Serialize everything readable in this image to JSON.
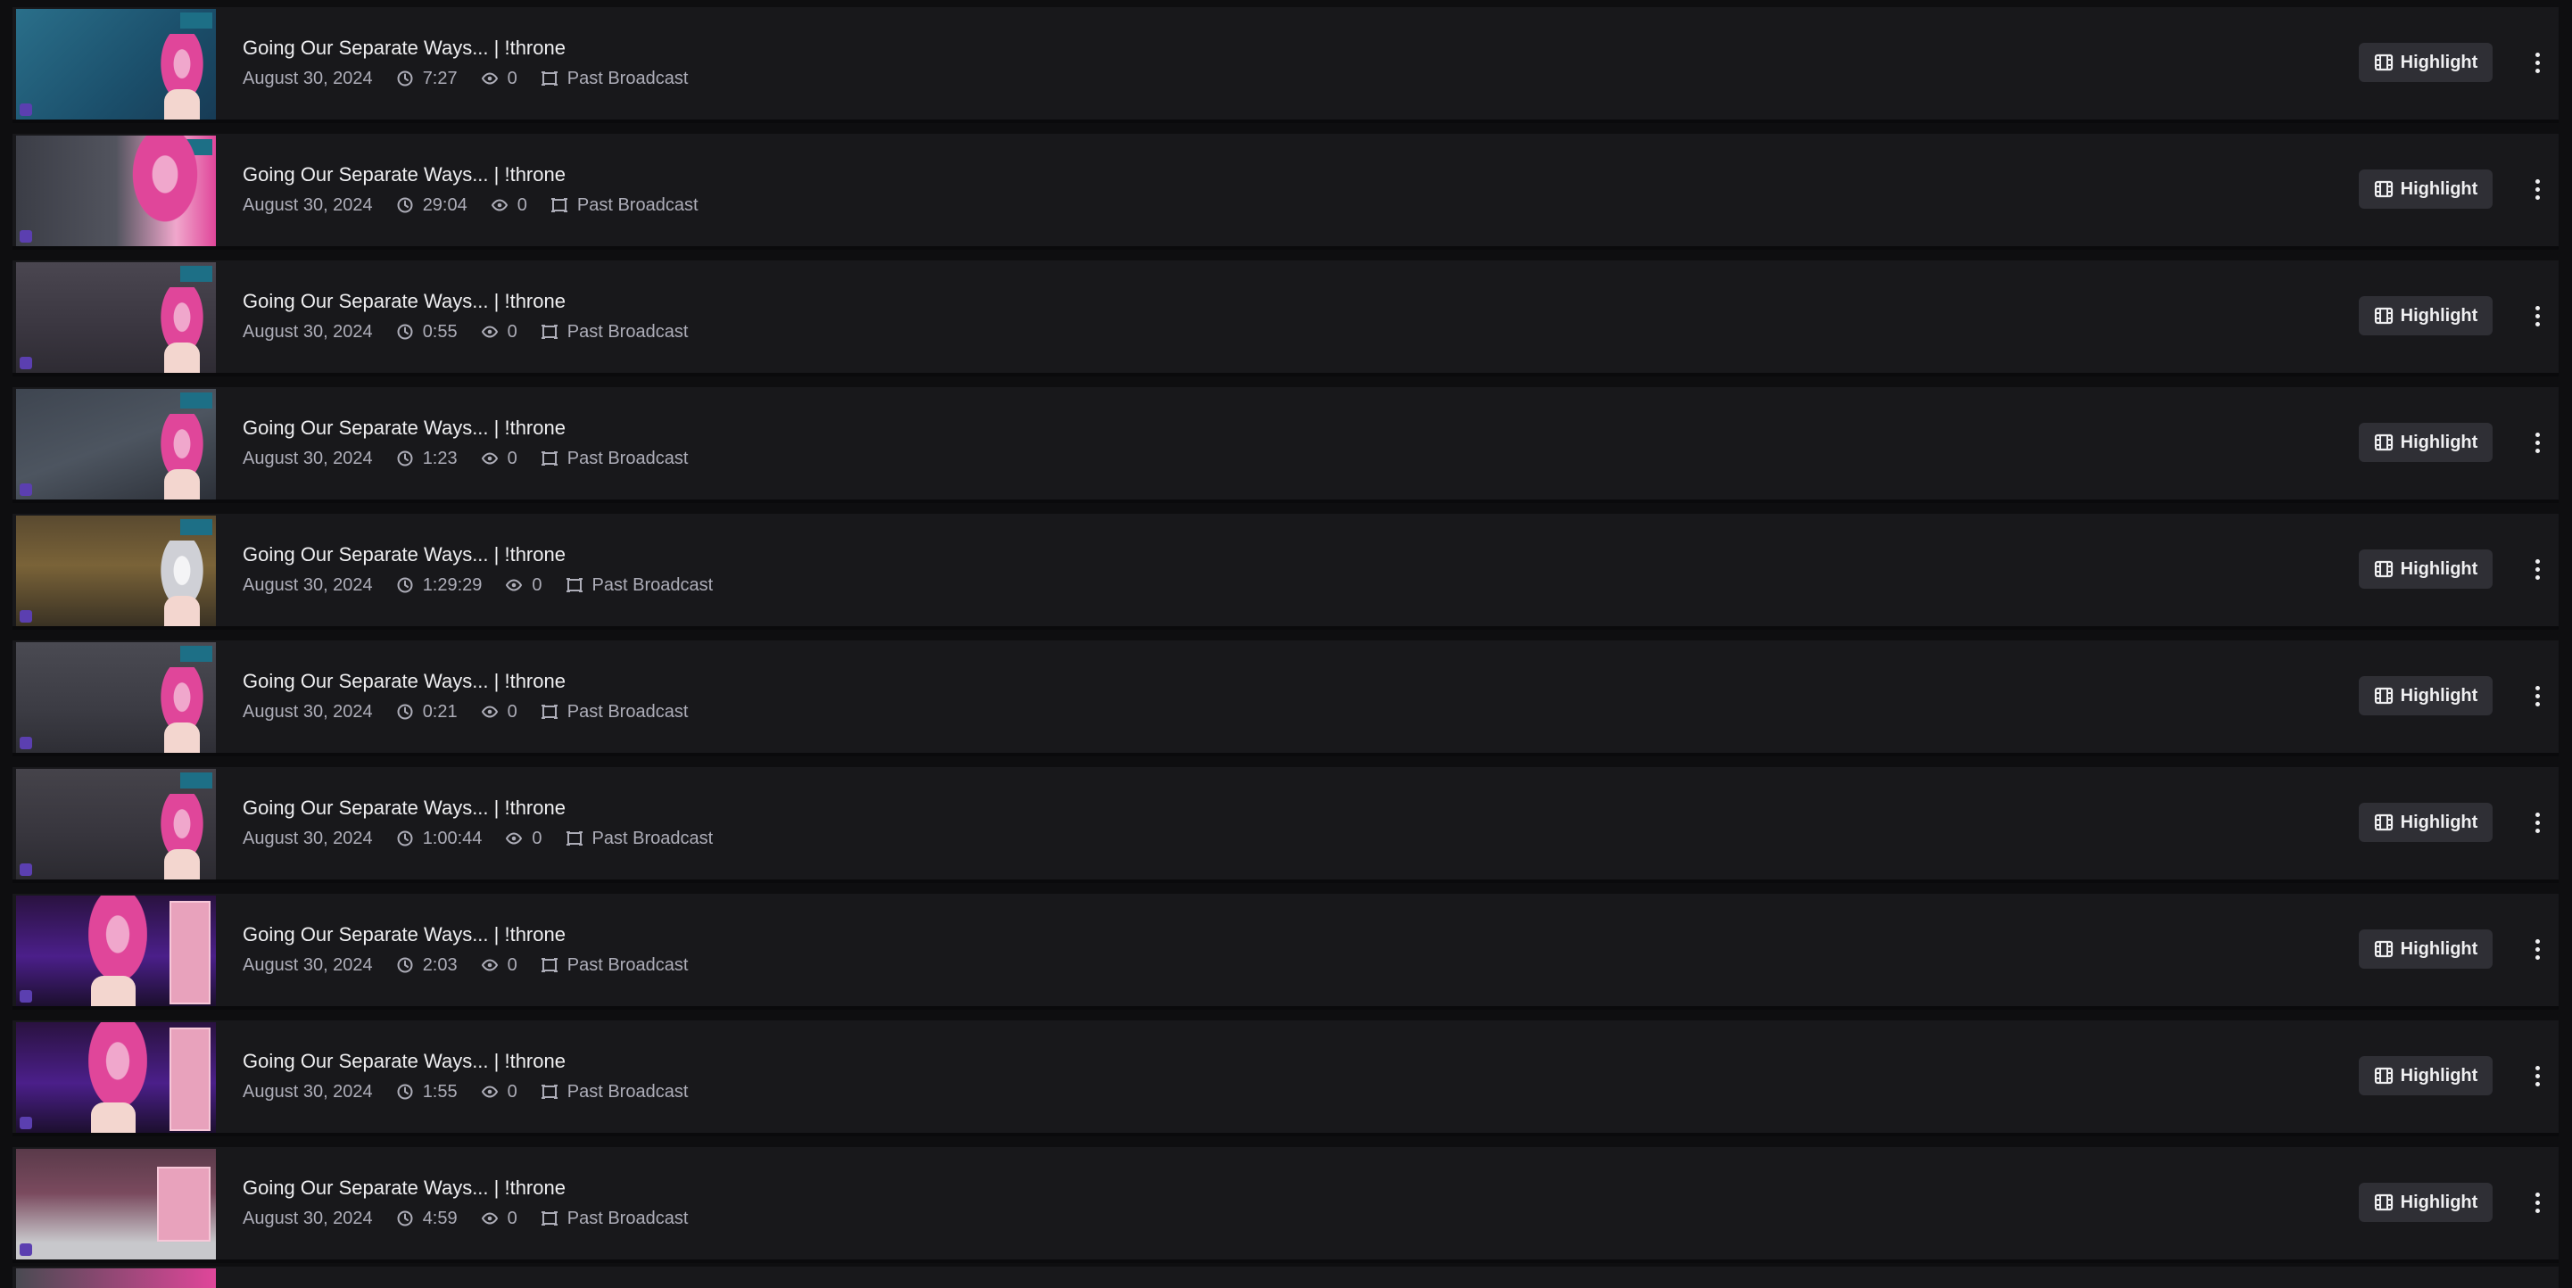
{
  "highlight_label": "Highlight",
  "icons": {
    "duration": "clock-icon",
    "views": "eye-icon",
    "type": "broadcast-icon",
    "highlight": "film-icon",
    "more": "kebab-icon"
  },
  "videos": [
    {
      "title": "Going Our Separate Ways... | !throne",
      "date": "August 30, 2024",
      "duration": "7:27",
      "views": "0",
      "type": "Past Broadcast"
    },
    {
      "title": "Going Our Separate Ways... | !throne",
      "date": "August 30, 2024",
      "duration": "29:04",
      "views": "0",
      "type": "Past Broadcast"
    },
    {
      "title": "Going Our Separate Ways... | !throne",
      "date": "August 30, 2024",
      "duration": "0:55",
      "views": "0",
      "type": "Past Broadcast"
    },
    {
      "title": "Going Our Separate Ways... | !throne",
      "date": "August 30, 2024",
      "duration": "1:23",
      "views": "0",
      "type": "Past Broadcast"
    },
    {
      "title": "Going Our Separate Ways... | !throne",
      "date": "August 30, 2024",
      "duration": "1:29:29",
      "views": "0",
      "type": "Past Broadcast"
    },
    {
      "title": "Going Our Separate Ways... | !throne",
      "date": "August 30, 2024",
      "duration": "0:21",
      "views": "0",
      "type": "Past Broadcast"
    },
    {
      "title": "Going Our Separate Ways... | !throne",
      "date": "August 30, 2024",
      "duration": "1:00:44",
      "views": "0",
      "type": "Past Broadcast"
    },
    {
      "title": "Going Our Separate Ways... | !throne",
      "date": "August 30, 2024",
      "duration": "2:03",
      "views": "0",
      "type": "Past Broadcast"
    },
    {
      "title": "Going Our Separate Ways... | !throne",
      "date": "August 30, 2024",
      "duration": "1:55",
      "views": "0",
      "type": "Past Broadcast"
    },
    {
      "title": "Going Our Separate Ways... | !throne",
      "date": "August 30, 2024",
      "duration": "4:59",
      "views": "0",
      "type": "Past Broadcast"
    }
  ]
}
